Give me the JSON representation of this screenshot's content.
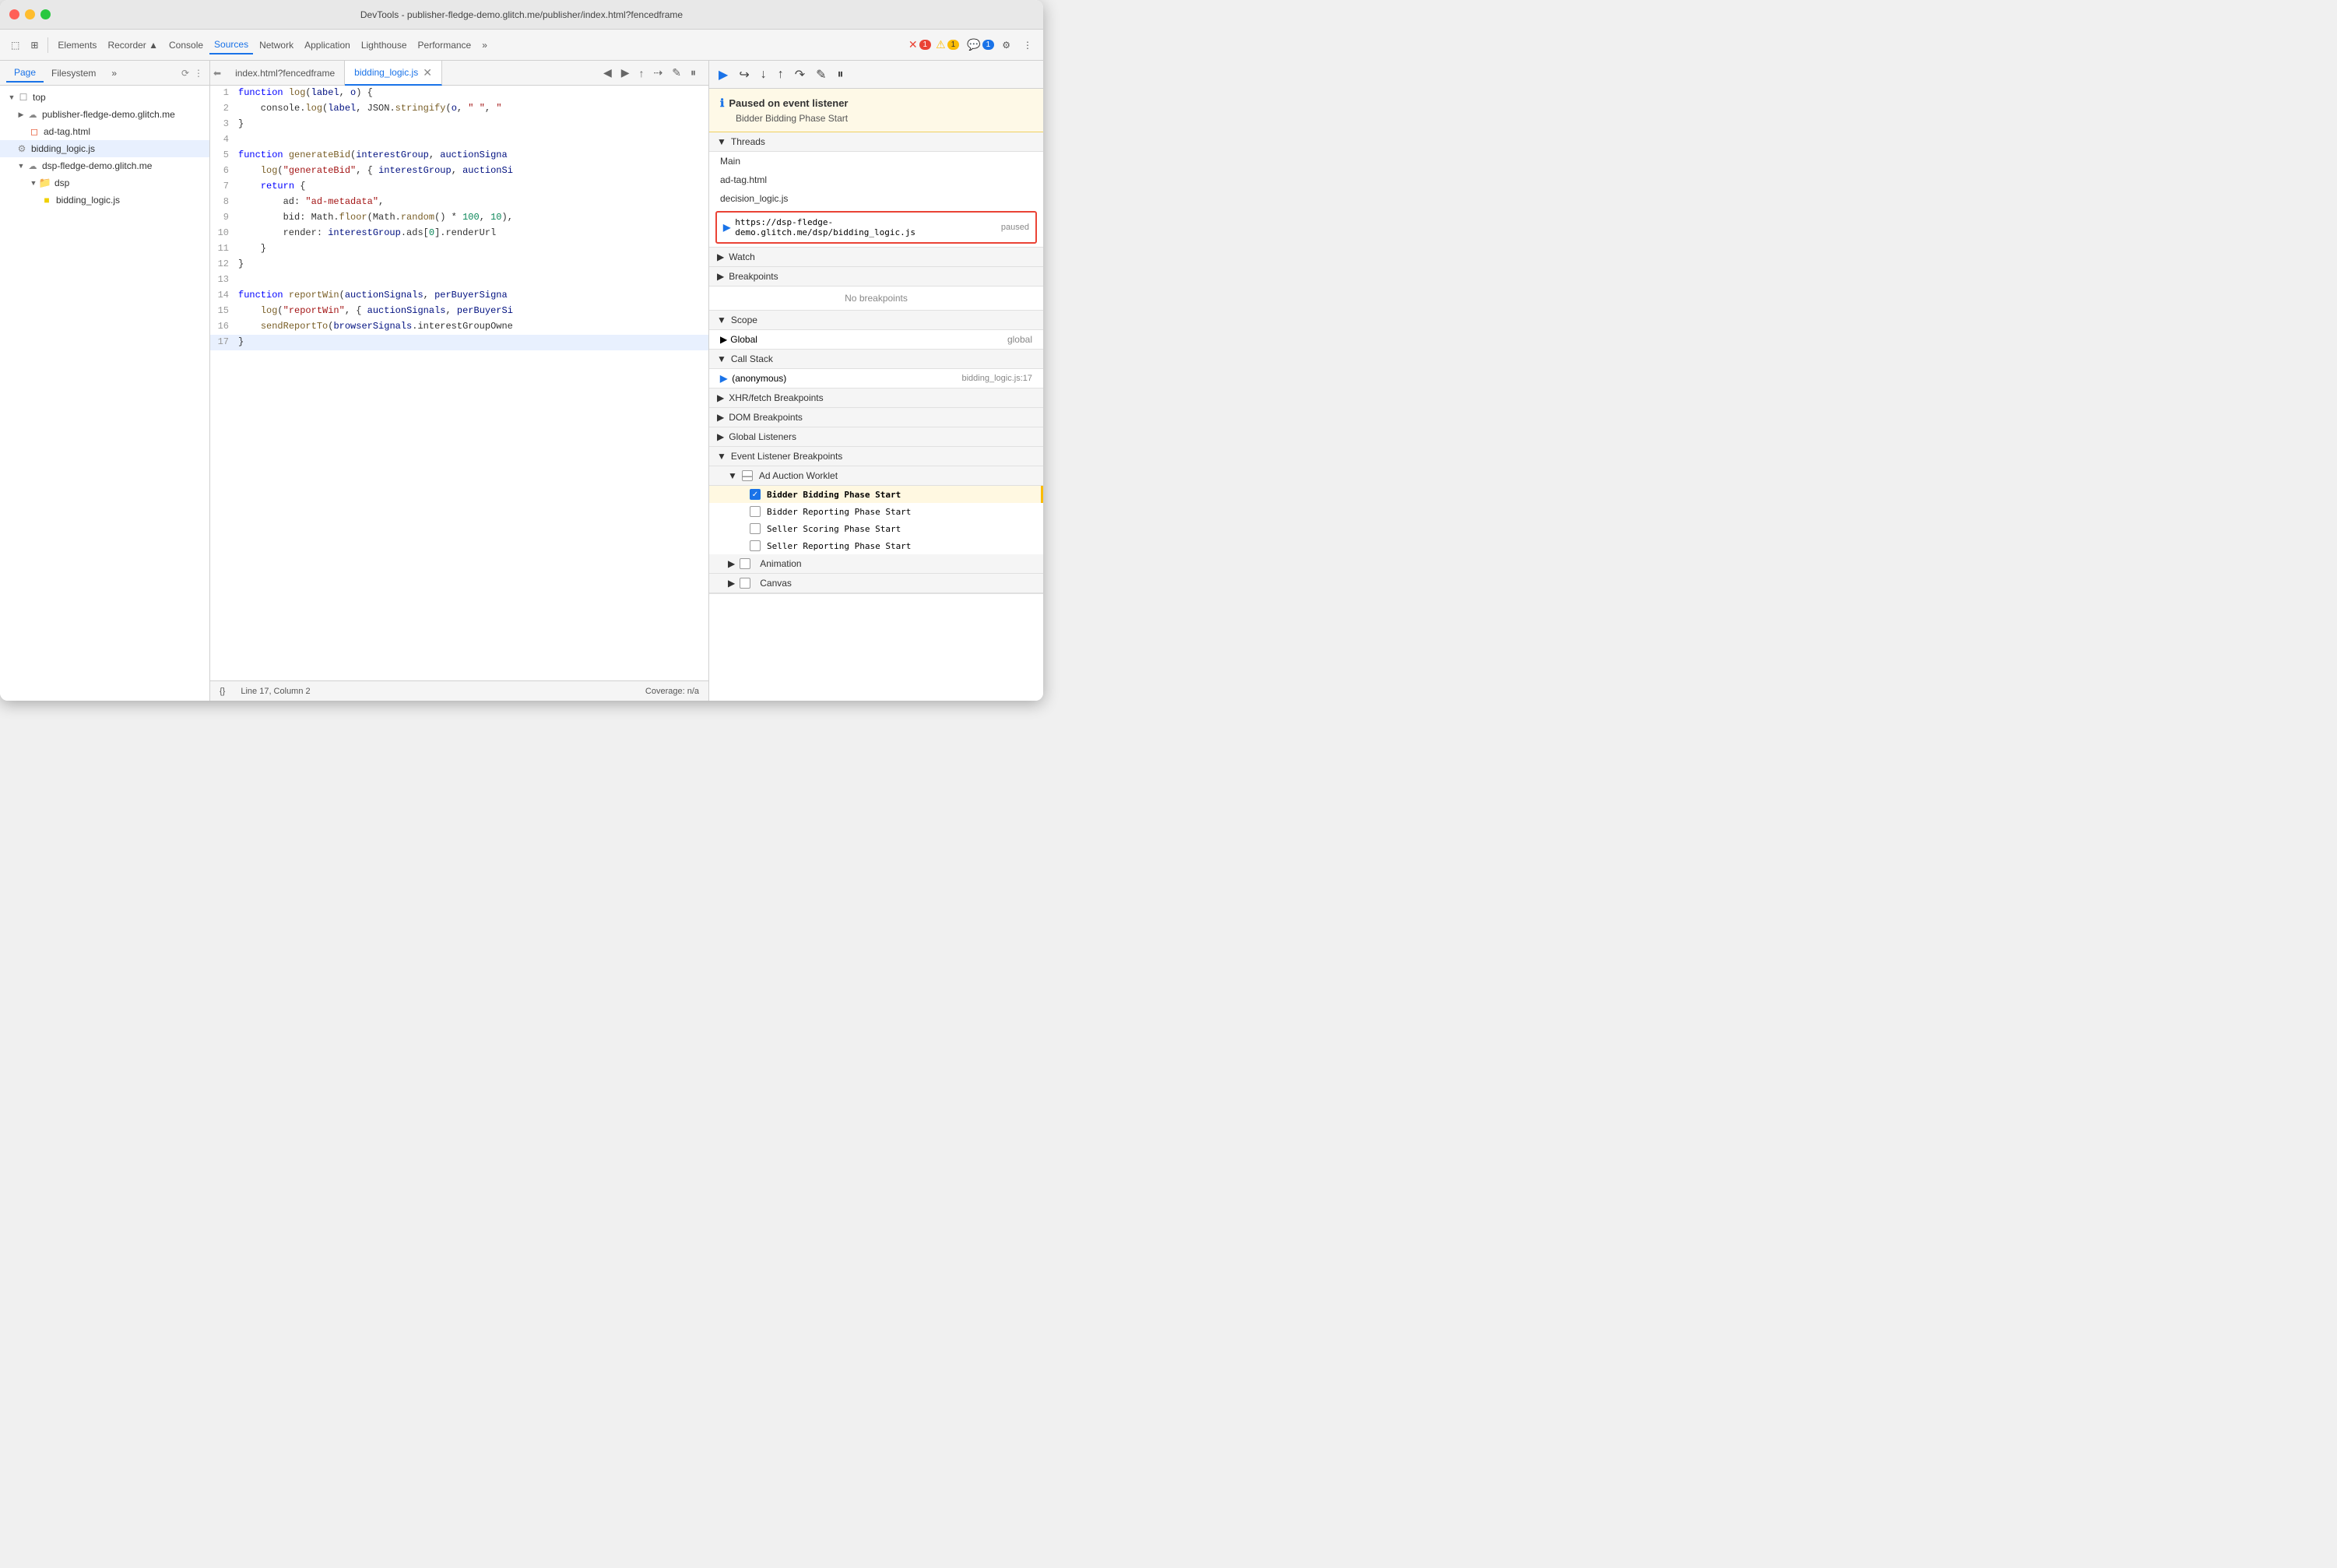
{
  "window": {
    "title": "DevTools - publisher-fledge-demo.glitch.me/publisher/index.html?fencedframe"
  },
  "toolbar": {
    "buttons": [
      "Elements",
      "Recorder ▲",
      "Console",
      "Sources",
      "Network",
      "Application",
      "Lighthouse",
      "Performance",
      "»"
    ],
    "active_tab": "Sources",
    "icons": {
      "cursor": "⬚",
      "layers": "⊞"
    },
    "badges": {
      "error_count": "1",
      "warn_count": "1",
      "chat_count": "1"
    }
  },
  "file_panel": {
    "tabs": [
      "Page",
      "Filesystem",
      "»"
    ],
    "active_tab": "Page",
    "tree": [
      {
        "id": "top",
        "label": "top",
        "indent": 0,
        "type": "root",
        "expanded": true
      },
      {
        "id": "publisher",
        "label": "publisher-fledge-demo.glitch.me",
        "indent": 1,
        "type": "cloud",
        "expanded": false
      },
      {
        "id": "ad-tag",
        "label": "ad-tag.html",
        "indent": 2,
        "type": "html"
      },
      {
        "id": "bidding_logic_parent",
        "label": "bidding_logic.js",
        "indent": 1,
        "type": "js-file",
        "selected": true
      },
      {
        "id": "dsp",
        "label": "dsp-fledge-demo.glitch.me",
        "indent": 1,
        "type": "cloud",
        "expanded": true
      },
      {
        "id": "dsp_folder",
        "label": "dsp",
        "indent": 2,
        "type": "folder",
        "expanded": true
      },
      {
        "id": "bidding_logic_js",
        "label": "bidding_logic.js",
        "indent": 3,
        "type": "js-file",
        "selected": false
      }
    ]
  },
  "editor": {
    "tabs": [
      {
        "label": "index.html?fencedframe",
        "active": false
      },
      {
        "label": "bidding_logic.js",
        "active": true,
        "closeable": true
      }
    ],
    "code_lines": [
      {
        "num": 1,
        "content": "function log(label, o) {"
      },
      {
        "num": 2,
        "content": "    console.log(label, JSON.stringify(o, \" \", \""
      },
      {
        "num": 3,
        "content": "}"
      },
      {
        "num": 4,
        "content": ""
      },
      {
        "num": 5,
        "content": "function generateBid(interestGroup, auctionSigna"
      },
      {
        "num": 6,
        "content": "    log(\"generateBid\", { interestGroup, auctionSi"
      },
      {
        "num": 7,
        "content": "    return {"
      },
      {
        "num": 8,
        "content": "        ad: \"ad-metadata\","
      },
      {
        "num": 9,
        "content": "        bid: Math.floor(Math.random() * 100, 10),"
      },
      {
        "num": 10,
        "content": "        render: interestGroup.ads[0].renderUrl"
      },
      {
        "num": 11,
        "content": "    }"
      },
      {
        "num": 12,
        "content": "}"
      },
      {
        "num": 13,
        "content": ""
      },
      {
        "num": 14,
        "content": "function reportWin(auctionSignals, perBuyerSigna"
      },
      {
        "num": 15,
        "content": "    log(\"reportWin\", { auctionSignals, perBuyerSi"
      },
      {
        "num": 16,
        "content": "    sendReportTo(browserSignals.interestGroupOwne"
      },
      {
        "num": 17,
        "content": "}"
      }
    ],
    "highlighted_line": 17
  },
  "status_bar": {
    "format_btn": "{}",
    "position": "Line 17, Column 2",
    "coverage": "Coverage: n/a"
  },
  "debug_panel": {
    "paused": {
      "title": "Paused on event listener",
      "subtitle": "Bidder Bidding Phase Start"
    },
    "threads": {
      "title": "Threads",
      "items": [
        {
          "label": "Main"
        },
        {
          "label": "ad-tag.html"
        },
        {
          "label": "decision_logic.js"
        },
        {
          "label": "https://dsp-fledge-demo.glitch.me/dsp/bidding_logic.js",
          "active": true,
          "status": "paused"
        }
      ]
    },
    "watch": {
      "title": "Watch"
    },
    "breakpoints": {
      "title": "Breakpoints",
      "empty_message": "No breakpoints"
    },
    "scope": {
      "title": "Scope",
      "items": [
        {
          "label": "Global",
          "value": "global"
        }
      ]
    },
    "call_stack": {
      "title": "Call Stack",
      "items": [
        {
          "fn": "(anonymous)",
          "loc": "bidding_logic.js:17",
          "active": true
        }
      ]
    },
    "xhr_breakpoints": {
      "title": "XHR/fetch Breakpoints"
    },
    "dom_breakpoints": {
      "title": "DOM Breakpoints"
    },
    "global_listeners": {
      "title": "Global Listeners"
    },
    "event_listener_breakpoints": {
      "title": "Event Listener Breakpoints",
      "sections": [
        {
          "label": "Ad Auction Worklet",
          "expanded": true,
          "items": [
            {
              "label": "Bidder Bidding Phase Start",
              "checked": true,
              "highlighted": true
            },
            {
              "label": "Bidder Reporting Phase Start",
              "checked": false
            },
            {
              "label": "Seller Scoring Phase Start",
              "checked": false
            },
            {
              "label": "Seller Reporting Phase Start",
              "checked": false
            }
          ]
        },
        {
          "label": "Animation",
          "expanded": false
        },
        {
          "label": "Canvas",
          "expanded": false
        }
      ]
    }
  }
}
